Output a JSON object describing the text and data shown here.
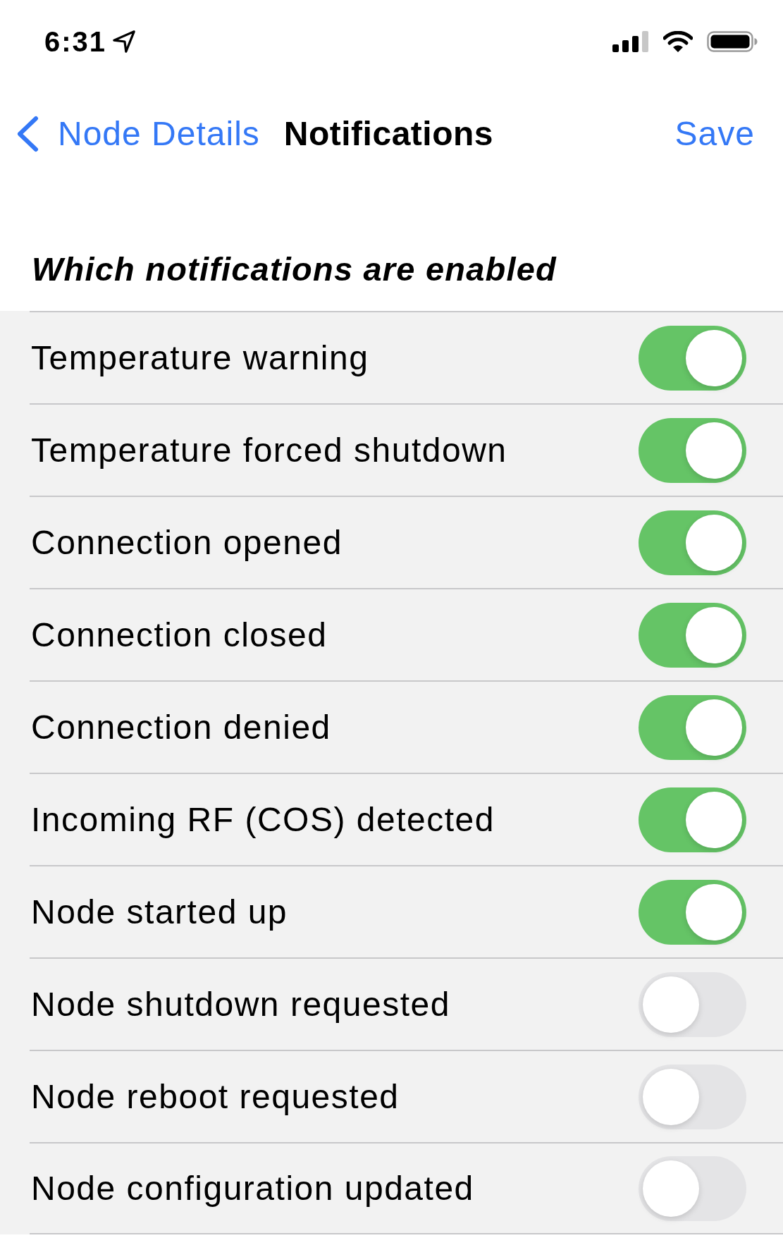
{
  "status_bar": {
    "time": "6:31"
  },
  "nav_bar": {
    "back": {
      "label": "Node Details"
    },
    "title": "Notifications",
    "action": "Save"
  },
  "section": {
    "header": "Which notifications are enabled",
    "items": [
      {
        "label": "Temperature warning",
        "on": true
      },
      {
        "label": "Temperature forced shutdown",
        "on": true
      },
      {
        "label": "Connection opened",
        "on": true
      },
      {
        "label": "Connection closed",
        "on": true
      },
      {
        "label": "Connection denied",
        "on": true
      },
      {
        "label": "Incoming RF (COS) detected",
        "on": true
      },
      {
        "label": "Node started up",
        "on": true
      },
      {
        "label": "Node shutdown requested",
        "on": false
      },
      {
        "label": "Node reboot requested",
        "on": false
      },
      {
        "label": "Node configuration updated",
        "on": false
      }
    ]
  }
}
